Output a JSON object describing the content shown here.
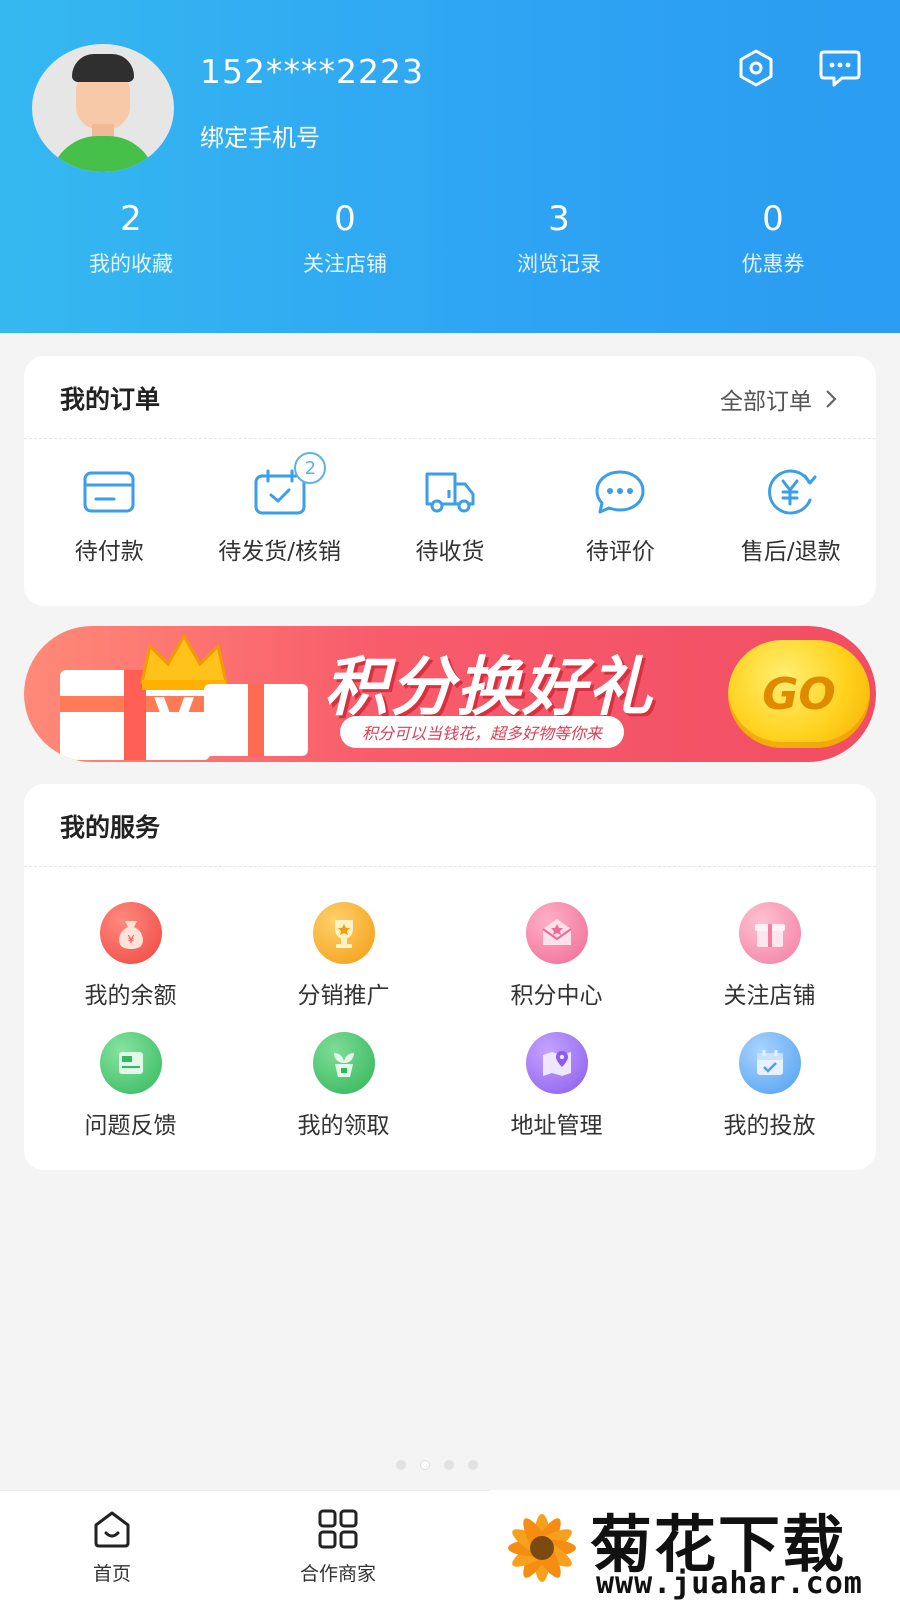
{
  "profile": {
    "phone": "152****2223",
    "bind_phone": "绑定手机号"
  },
  "header_icons": [
    "settings-icon",
    "message-icon"
  ],
  "stats": [
    {
      "value": "2",
      "label": "我的收藏"
    },
    {
      "value": "0",
      "label": "关注店铺"
    },
    {
      "value": "3",
      "label": "浏览记录"
    },
    {
      "value": "0",
      "label": "优惠券"
    }
  ],
  "orders": {
    "title": "我的订单",
    "all_orders": "全部订单",
    "items": [
      {
        "label": "待付款",
        "icon": "wallet-card-icon"
      },
      {
        "label": "待发货/核销",
        "icon": "calendar-check-icon",
        "badge": "2"
      },
      {
        "label": "待收货",
        "icon": "truck-icon"
      },
      {
        "label": "待评价",
        "icon": "chat-bubble-icon"
      },
      {
        "label": "售后/退款",
        "icon": "yuan-refund-icon"
      }
    ]
  },
  "banner": {
    "title": "积分换好礼",
    "subtitle": "积分可以当钱花，超多好物等你来",
    "go": "GO"
  },
  "services": {
    "title": "我的服务",
    "items": [
      {
        "label": "我的余额",
        "icon": "money-bag-icon",
        "color": "#f4564f"
      },
      {
        "label": "分销推广",
        "icon": "trophy-icon",
        "color": "#f6a623"
      },
      {
        "label": "积分中心",
        "icon": "envelope-star-icon",
        "color": "#f37ba0"
      },
      {
        "label": "关注店铺",
        "icon": "gift-box-icon",
        "color": "#f48aa7"
      },
      {
        "label": "问题反馈",
        "icon": "feedback-box-icon",
        "color": "#43c46a"
      },
      {
        "label": "我的领取",
        "icon": "plant-pot-icon",
        "color": "#3ebd63"
      },
      {
        "label": "地址管理",
        "icon": "map-pin-icon",
        "color": "#9a6cf0"
      },
      {
        "label": "我的投放",
        "icon": "calendar-icon",
        "color": "#5aa7f2"
      }
    ]
  },
  "tabbar": [
    {
      "label": "首页",
      "icon": "home-icon"
    },
    {
      "label": "合作商家",
      "icon": "grid-icon"
    }
  ],
  "watermark": {
    "text": "菊花下载网",
    "url": "www.juahar.com"
  },
  "colors": {
    "header_start": "#35b8f0",
    "header_end": "#2a9cf2",
    "icon_blue": "#3a9ee8",
    "banner": "#f14d64"
  }
}
